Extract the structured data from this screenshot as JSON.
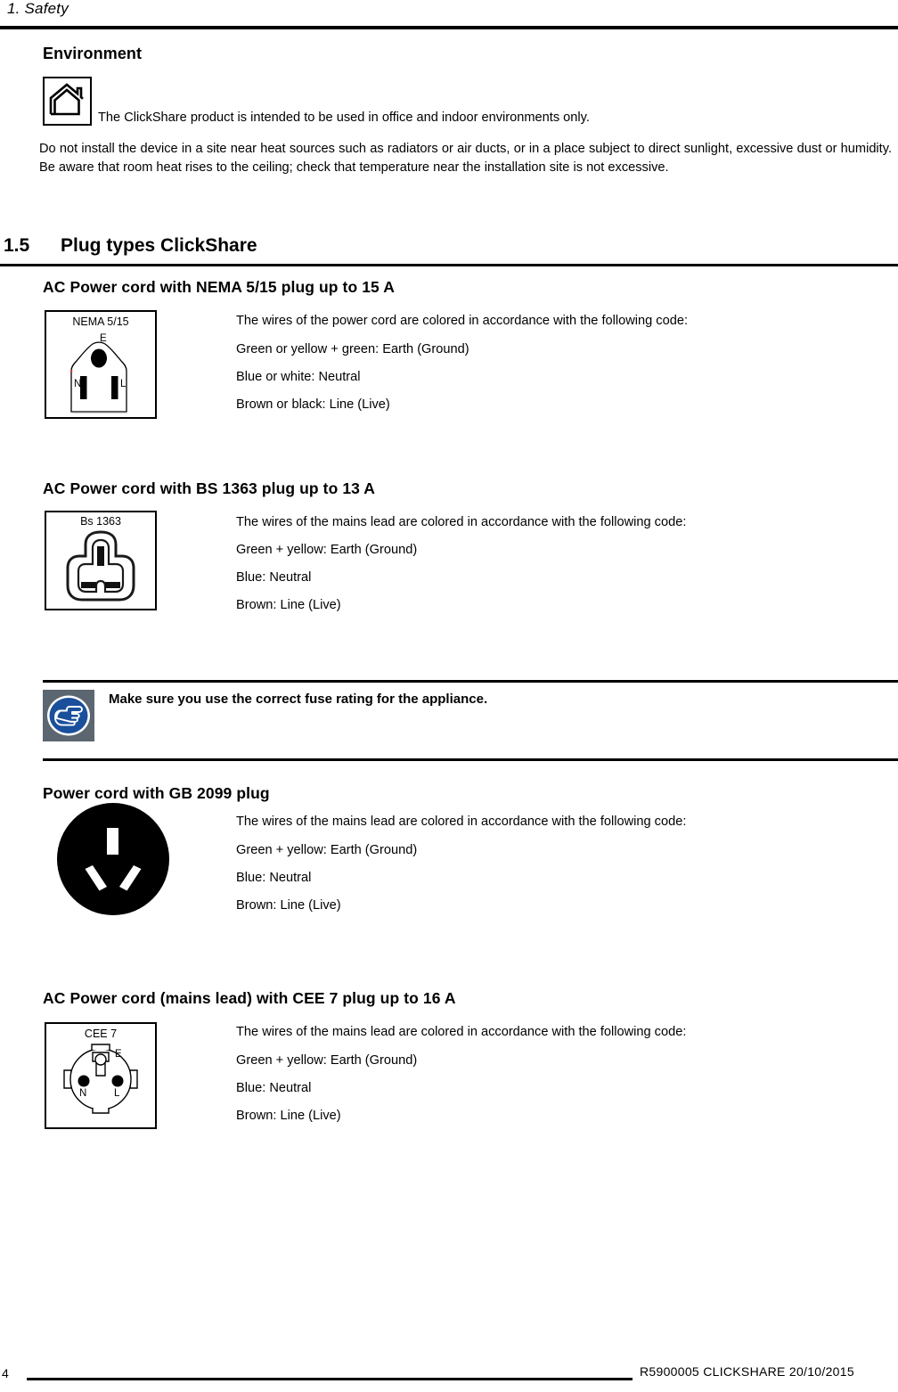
{
  "header": {
    "chapter": "1.  Safety"
  },
  "environment": {
    "heading": "Environment",
    "icon_name": "house-indoor-icon",
    "icon_caption_text": "The ClickShare product is intended to be used in office and indoor environments only.",
    "paragraph": "Do not install the device in a site near heat sources such as radiators or air ducts, or in a place subject to direct sunlight, excessive dust or humidity.  Be aware that room heat rises to the ceiling; check that temperature near the installation site is not excessive."
  },
  "section": {
    "number": "1.5",
    "title": "Plug types ClickShare"
  },
  "plugs": [
    {
      "heading": "AC Power cord with NEMA 5/15 plug up to 15 A",
      "figure_caption": "NEMA 5/15",
      "figure_labels": {
        "earth": "E",
        "neutral": "N",
        "line": "L"
      },
      "lines": [
        "The wires of the power cord are colored in accordance with the following code:",
        "Green or yellow + green:  Earth (Ground)",
        "Blue or white:  Neutral",
        "Brown or black:  Line (Live)"
      ]
    },
    {
      "heading": "AC Power cord with BS 1363 plug up to 13 A",
      "figure_caption": "Bs 1363",
      "figure_labels": {},
      "lines": [
        "The wires of the mains lead are colored in accordance with the following code:",
        "Green + yellow:  Earth (Ground)",
        "Blue:  Neutral",
        "Brown:  Line (Live)"
      ]
    },
    {
      "heading": "Power cord with GB 2099 plug",
      "figure_caption": "",
      "figure_labels": {},
      "lines": [
        "The wires of the mains lead are colored in accordance with the following code:",
        "Green + yellow:  Earth (Ground)",
        "Blue:  Neutral",
        "Brown:  Line (Live)"
      ]
    },
    {
      "heading": "AC Power cord (mains lead) with CEE 7 plug up to 16 A",
      "figure_caption": "CEE 7",
      "figure_labels": {
        "earth": "E",
        "neutral": "N",
        "line": "L"
      },
      "lines": [
        "The wires of the mains lead are colored in accordance with the following code:",
        "Green + yellow:  Earth (Ground)",
        "Blue:  Neutral",
        "Brown:  Line (Live)"
      ]
    }
  ],
  "note": {
    "icon_name": "pointing-hand-note-icon",
    "text": "Make sure you use the correct fuse rating for the appliance.",
    "icon_background_color": "#5b6670",
    "icon_circle_color": "#1a4f9c"
  },
  "footer": {
    "page_number": "4",
    "meta": "R5900005   CLICKSHARE  20/10/2015"
  }
}
